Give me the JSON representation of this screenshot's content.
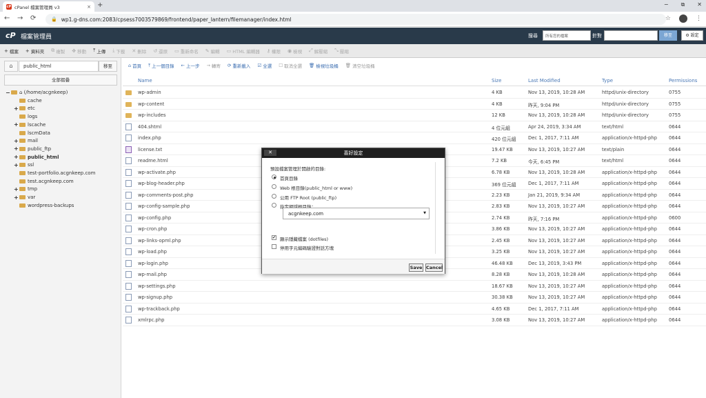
{
  "browser": {
    "tab_title": "cPanel 檔案管理員 v3",
    "tab_close": "×",
    "new_tab": "+",
    "favicon_text": "cP",
    "url": "wp1.g-dns.com:2083/cpsess7003579869/frontend/paper_lantern/filemanager/index.html",
    "window_controls": [
      "−",
      "⧉",
      "✕"
    ],
    "nav": {
      "back": "←",
      "forward": "→",
      "reload": "⟳"
    },
    "right_icons": {
      "star": "☆",
      "menu": "⋮"
    }
  },
  "cpanel": {
    "logo": "cP",
    "title": "檔案管理員",
    "search_label": "搜尋",
    "search_scope": "所有您的檔案",
    "for_label": "針對",
    "go_label": "移至",
    "settings_label": "⚙ 設定"
  },
  "toolbar": [
    {
      "label": "檔案",
      "icon": "+",
      "enabled": true
    },
    {
      "label": "資料夾",
      "icon": "+",
      "enabled": true
    },
    {
      "label": "複製",
      "icon": "⧉",
      "enabled": false
    },
    {
      "label": "移動",
      "icon": "✥",
      "enabled": false
    },
    {
      "label": "上傳",
      "icon": "⤒",
      "enabled": true
    },
    {
      "label": "下載",
      "icon": "⤓",
      "enabled": false
    },
    {
      "label": "刪除",
      "icon": "✕",
      "enabled": false
    },
    {
      "label": "還原",
      "icon": "↺",
      "enabled": false
    },
    {
      "label": "重新命名",
      "icon": "▭",
      "enabled": false
    },
    {
      "label": "編輯",
      "icon": "✎",
      "enabled": false
    },
    {
      "label": "HTML 編輯器",
      "icon": "▭",
      "enabled": false
    },
    {
      "label": "權限",
      "icon": "⚷",
      "enabled": false
    },
    {
      "label": "檢視",
      "icon": "◉",
      "enabled": false
    },
    {
      "label": "解壓縮",
      "icon": "⤢",
      "enabled": false
    },
    {
      "label": "壓縮",
      "icon": "⤡",
      "enabled": false
    }
  ],
  "sidebar": {
    "home_icon": "⌂",
    "path_value": "public_html",
    "go_label": "移至",
    "collapse_label": "全部摺疊",
    "tree": [
      {
        "label": "(/home/acgnkeep)",
        "pm": "−",
        "home": true,
        "level": 0
      },
      {
        "label": "cache",
        "pm": "",
        "level": 1
      },
      {
        "label": "etc",
        "pm": "+",
        "level": 1
      },
      {
        "label": "logs",
        "pm": "",
        "level": 1
      },
      {
        "label": "lscache",
        "pm": "+",
        "level": 1
      },
      {
        "label": "lscmData",
        "pm": "",
        "level": 1
      },
      {
        "label": "mail",
        "pm": "+",
        "level": 1
      },
      {
        "label": "public_ftp",
        "pm": "+",
        "level": 1
      },
      {
        "label": "public_html",
        "pm": "+",
        "level": 1,
        "bold": true
      },
      {
        "label": "ssl",
        "pm": "+",
        "level": 1
      },
      {
        "label": "test-portfolio.acgnkeep.com",
        "pm": "",
        "level": 1
      },
      {
        "label": "test.acgnkeep.com",
        "pm": "",
        "level": 1
      },
      {
        "label": "tmp",
        "pm": "+",
        "level": 1
      },
      {
        "label": "var",
        "pm": "+",
        "level": 1
      },
      {
        "label": "wordpress-backups",
        "pm": "",
        "level": 1
      }
    ]
  },
  "navbar": [
    {
      "label": "首頁",
      "icon": "⌂",
      "enabled": true
    },
    {
      "label": "上一個目錄",
      "icon": "⤒",
      "enabled": true
    },
    {
      "label": "上一步",
      "icon": "←",
      "enabled": true
    },
    {
      "label": "轉寄",
      "icon": "→",
      "enabled": false
    },
    {
      "label": "重新載入",
      "icon": "⟳",
      "enabled": true
    },
    {
      "label": "全選",
      "icon": "☑",
      "enabled": true
    },
    {
      "label": "取消全選",
      "icon": "☐",
      "enabled": false
    },
    {
      "label": "檢視垃圾桶",
      "icon": "🗑",
      "enabled": true
    },
    {
      "label": "清空垃圾桶",
      "icon": "🗑",
      "enabled": false
    }
  ],
  "table": {
    "headers": {
      "name": "Name",
      "size": "Size",
      "modified": "Last Modified",
      "type": "Type",
      "perms": "Permissions"
    },
    "rows": [
      {
        "kind": "folder",
        "name": "wp-admin",
        "size": "4 KB",
        "modified": "Nov 13, 2019, 10:28 AM",
        "type": "httpd/unix-directory",
        "perms": "0755"
      },
      {
        "kind": "folder",
        "name": "wp-content",
        "size": "4 KB",
        "modified": "昨天, 9:04 PM",
        "type": "httpd/unix-directory",
        "perms": "0755"
      },
      {
        "kind": "folder",
        "name": "wp-includes",
        "size": "12 KB",
        "modified": "Nov 13, 2019, 10:28 AM",
        "type": "httpd/unix-directory",
        "perms": "0755"
      },
      {
        "kind": "file",
        "name": "404.shtml",
        "size": "4 位元組",
        "modified": "Apr 24, 2019, 3:34 AM",
        "type": "text/html",
        "perms": "0644"
      },
      {
        "kind": "file",
        "name": "index.php",
        "size": "420 位元組",
        "modified": "Dec 1, 2017, 7:11 AM",
        "type": "application/x-httpd-php",
        "perms": "0644"
      },
      {
        "kind": "txt",
        "name": "license.txt",
        "size": "19.47 KB",
        "modified": "Nov 13, 2019, 10:27 AM",
        "type": "text/plain",
        "perms": "0644"
      },
      {
        "kind": "file",
        "name": "readme.html",
        "size": "7.2 KB",
        "modified": "今天, 6:45 PM",
        "type": "text/html",
        "perms": "0644"
      },
      {
        "kind": "file",
        "name": "wp-activate.php",
        "size": "6.78 KB",
        "modified": "Nov 13, 2019, 10:28 AM",
        "type": "application/x-httpd-php",
        "perms": "0644"
      },
      {
        "kind": "file",
        "name": "wp-blog-header.php",
        "size": "369 位元組",
        "modified": "Dec 1, 2017, 7:11 AM",
        "type": "application/x-httpd-php",
        "perms": "0644"
      },
      {
        "kind": "file",
        "name": "wp-comments-post.php",
        "size": "2.23 KB",
        "modified": "Jan 21, 2019, 9:34 AM",
        "type": "application/x-httpd-php",
        "perms": "0644"
      },
      {
        "kind": "file",
        "name": "wp-config-sample.php",
        "size": "2.83 KB",
        "modified": "Nov 13, 2019, 10:27 AM",
        "type": "application/x-httpd-php",
        "perms": "0644"
      },
      {
        "kind": "file",
        "name": "wp-config.php",
        "size": "2.74 KB",
        "modified": "昨天, 7:16 PM",
        "type": "application/x-httpd-php",
        "perms": "0600"
      },
      {
        "kind": "file",
        "name": "wp-cron.php",
        "size": "3.86 KB",
        "modified": "Nov 13, 2019, 10:27 AM",
        "type": "application/x-httpd-php",
        "perms": "0644"
      },
      {
        "kind": "file",
        "name": "wp-links-opml.php",
        "size": "2.45 KB",
        "modified": "Nov 13, 2019, 10:27 AM",
        "type": "application/x-httpd-php",
        "perms": "0644"
      },
      {
        "kind": "file",
        "name": "wp-load.php",
        "size": "3.25 KB",
        "modified": "Nov 13, 2019, 10:27 AM",
        "type": "application/x-httpd-php",
        "perms": "0644"
      },
      {
        "kind": "file",
        "name": "wp-login.php",
        "size": "46.48 KB",
        "modified": "Dec 13, 2019, 3:43 PM",
        "type": "application/x-httpd-php",
        "perms": "0644"
      },
      {
        "kind": "file",
        "name": "wp-mail.php",
        "size": "8.28 KB",
        "modified": "Nov 13, 2019, 10:28 AM",
        "type": "application/x-httpd-php",
        "perms": "0644"
      },
      {
        "kind": "file",
        "name": "wp-settings.php",
        "size": "18.67 KB",
        "modified": "Nov 13, 2019, 10:27 AM",
        "type": "application/x-httpd-php",
        "perms": "0644"
      },
      {
        "kind": "file",
        "name": "wp-signup.php",
        "size": "30.38 KB",
        "modified": "Nov 13, 2019, 10:27 AM",
        "type": "application/x-httpd-php",
        "perms": "0644"
      },
      {
        "kind": "file",
        "name": "wp-trackback.php",
        "size": "4.65 KB",
        "modified": "Dec 1, 2017, 7:11 AM",
        "type": "application/x-httpd-php",
        "perms": "0644"
      },
      {
        "kind": "file",
        "name": "xmlrpc.php",
        "size": "3.08 KB",
        "modified": "Nov 13, 2019, 10:27 AM",
        "type": "application/x-httpd-php",
        "perms": "0644"
      }
    ]
  },
  "modal": {
    "title": "喜好設定",
    "close": "✕",
    "intro": "預設檔案管理於開啟的目錄:",
    "options": [
      {
        "label": "首頁目錄",
        "checked": true
      },
      {
        "label": "Web 根目錄(public_html or www)",
        "checked": false
      },
      {
        "label": "公用 FTP Root (public_ftp)",
        "checked": false
      },
      {
        "label": "指定網域根目錄：",
        "checked": false
      }
    ],
    "domain_value": "acgnkeep.com",
    "domain_arrow": "▼",
    "checks": [
      {
        "label": "顯示隱藏檔案 (dotfiles)",
        "checked": true
      },
      {
        "label": "停用字元編碼驗證對話方塊",
        "checked": false
      }
    ],
    "save_label": "Save",
    "cancel_label": "Cancel"
  }
}
